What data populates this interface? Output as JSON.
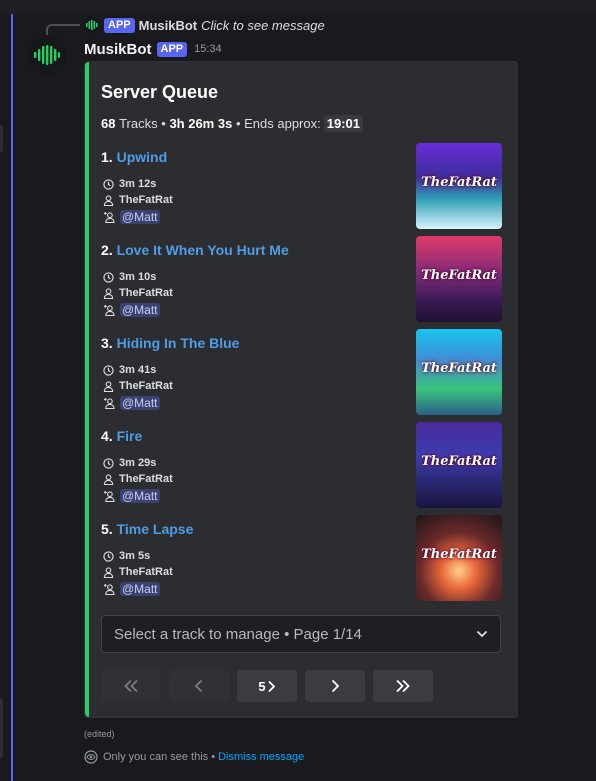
{
  "reply": {
    "app_tag": "APP",
    "bot_name": "MusikBot",
    "text": "Click to see message"
  },
  "message": {
    "author": "MusikBot",
    "app_tag": "APP",
    "time": "15:34",
    "edited": "(edited)"
  },
  "embed": {
    "title": "Server Queue",
    "summary": {
      "tracks_count": "68",
      "tracks_word": "Tracks",
      "separator": "•",
      "duration": "3h 26m 3s",
      "ends_label": "Ends approx:",
      "ends_time": "19:01"
    },
    "tracks": [
      {
        "num": "1.",
        "title": "Upwind",
        "duration": "3m 12s",
        "artist": "TheFatRat",
        "requester": "@Matt",
        "art_logo": "TheFatRat"
      },
      {
        "num": "2.",
        "title": "Love It When You Hurt Me",
        "duration": "3m 10s",
        "artist": "TheFatRat",
        "requester": "@Matt",
        "art_logo": "TheFatRat"
      },
      {
        "num": "3.",
        "title": "Hiding In The Blue",
        "duration": "3m 41s",
        "artist": "TheFatRat",
        "requester": "@Matt",
        "art_logo": "TheFatRat"
      },
      {
        "num": "4.",
        "title": "Fire",
        "duration": "3m 29s",
        "artist": "TheFatRat",
        "requester": "@Matt",
        "art_logo": "TheFatRat"
      },
      {
        "num": "5.",
        "title": "Time Lapse",
        "duration": "3m 5s",
        "artist": "TheFatRat",
        "requester": "@Matt",
        "art_logo": "TheFatRat"
      }
    ]
  },
  "select": {
    "placeholder": "Select a track to manage • Page 1/14"
  },
  "nav": {
    "page_button_label": "5"
  },
  "ephemeral": {
    "text": "Only you can see this •",
    "dismiss": "Dismiss message"
  },
  "colors": {
    "accent_bar": "#23d160",
    "link": "#4e9de6",
    "app_tag": "#5865f2",
    "embed_bg": "#2b2d31"
  },
  "icons": {
    "duration": "clock-icon",
    "artist": "person-icon",
    "requester": "user-add-icon",
    "select_chevron": "chevron-down-icon",
    "first_page": "double-chevron-left-icon",
    "prev": "chevron-left-icon",
    "next": "chevron-right-icon",
    "last_page": "double-chevron-right-icon",
    "ephemeral": "eye-icon"
  }
}
